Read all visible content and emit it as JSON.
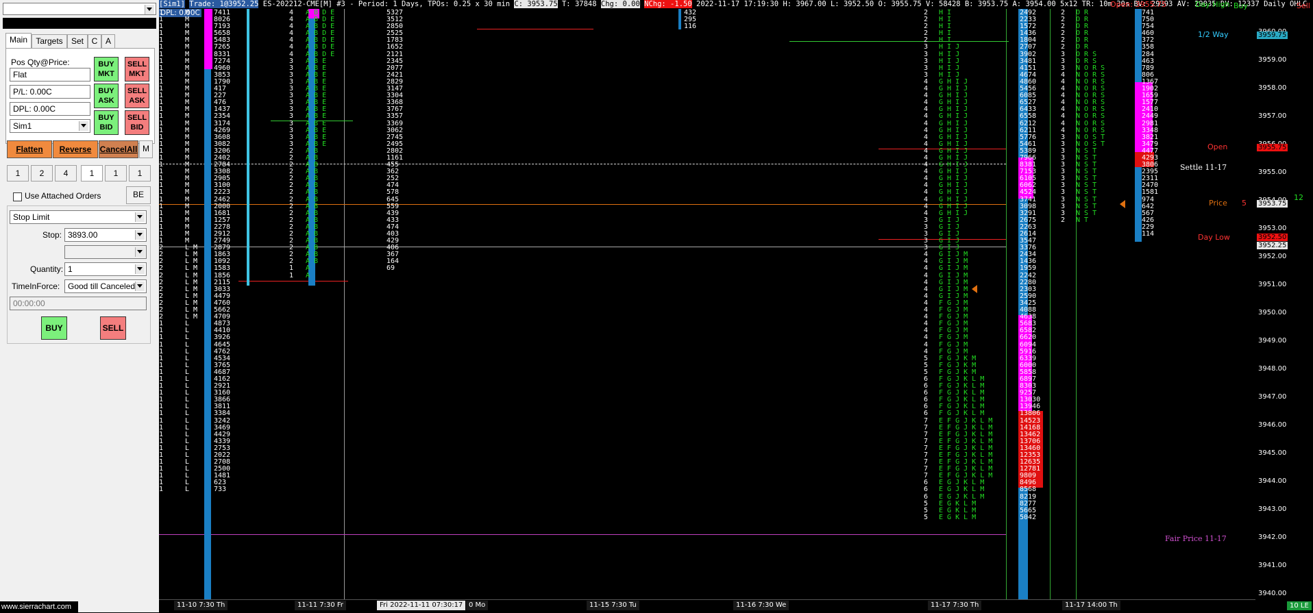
{
  "panel": {
    "symbol_select": "",
    "tabs": [
      "Main",
      "Targets",
      "Set",
      "C",
      "A"
    ],
    "pos_qty_label": "Pos Qty@Price:",
    "pos_value": "Flat",
    "pl_value": "P/L: 0.00C",
    "dpl_value": "DPL: 0.00C",
    "account": "Sim1",
    "buy_mkt": "BUY MKT",
    "sell_mkt": "SELL MKT",
    "buy_ask": "BUY ASK",
    "sell_ask": "SELL ASK",
    "buy_bid": "BUY BID",
    "sell_bid": "SELL BID",
    "flatten": "Flatten",
    "reverse": "Reverse",
    "cancel_all": "CancelAll",
    "m_button": "M",
    "qty_buttons": [
      "1",
      "2",
      "4",
      "1",
      "1",
      "1"
    ],
    "use_attached": "Use Attached Orders",
    "be_button": "BE",
    "order_type": "Stop Limit",
    "stop_label": "Stop:",
    "stop_value": "3893.00",
    "quantity_label": "Quantity:",
    "quantity_value": "1",
    "tif_label": "TimeInForce:",
    "tif_value": "Good till Canceled",
    "time_value": "00:00:00",
    "buy": "BUY",
    "sell": "SELL",
    "watermark": "www.sierrachart.com"
  },
  "header": {
    "account": "[Sim1]",
    "trade": "Trade: 1@3952.25",
    "symbol": "ES-202212-CME[M]",
    "study": "#3 - Period: 1 Days, TPOs: 0.25 x 30 min",
    "close": "C: 3953.75",
    "ticks": "T: 37848",
    "chg": "Chg: 0.00",
    "nchg": "NChg: -1.50",
    "datetime": "2022-11-17 17:19:30",
    "hlo": "H: 3967.00  L: 3952.50  O: 3955.75  V: 58428  B: 3953.75  A: 3954.00  5x12  TR: 10m 30s  BV: 29393  AV: 29035  DV: 12337  Daily OHLC",
    "open_label": "Open: 3955.75",
    "day_high": "Day High",
    "buy_col": "Buy",
    "sell_col": "Sell",
    "dpl": "DPL: 0.00C"
  },
  "price_axis": [
    {
      "p": "3960.00"
    },
    {
      "p": "3959.00"
    },
    {
      "p": "3958.00"
    },
    {
      "p": "3957.00"
    },
    {
      "p": "3956.00"
    },
    {
      "p": "3955.00"
    },
    {
      "p": "3954.00"
    },
    {
      "p": "3953.00"
    },
    {
      "p": "3952.00"
    },
    {
      "p": "3951.00"
    },
    {
      "p": "3950.00"
    },
    {
      "p": "3949.00"
    },
    {
      "p": "3948.00"
    },
    {
      "p": "3947.00"
    },
    {
      "p": "3946.00"
    },
    {
      "p": "3945.00"
    },
    {
      "p": "3944.00"
    },
    {
      "p": "3943.00"
    },
    {
      "p": "3942.00"
    },
    {
      "p": "3941.00"
    },
    {
      "p": "3940.00"
    }
  ],
  "price_tags": {
    "half_way": "3959.75",
    "open": "3955.75",
    "current": "3953.75",
    "day_low": "3952.50",
    "last": "3952.25"
  },
  "level_labels": {
    "half_way": "1/2 Way",
    "open": "Open",
    "settle": "Settle 11-17",
    "price": "Price",
    "price_qty": "5",
    "day_low": "Day Low",
    "fair_price": "Fair Price 11-17",
    "qty12": "12"
  },
  "dates": [
    "11-10  7:30 Th",
    "11-11  7:30 Fr",
    "Fri 2022-11-11  07:30:17",
    "0 Mo",
    "11-15  7:30 Tu",
    "11-16  7:30 We",
    "11-17  7:30 Th",
    "11-17  14:00 Th"
  ],
  "status": "10 LE",
  "profiles": {
    "p1_counts": "1\n1\n1\n1\n1\n1\n1\n1\n1\n1\n1\n1\n1\n1\n1\n1\n1\n1\n1\n1\n1\n1\n1\n1\n1\n1\n1\n1\n1\n1\n1\n1\n1\n1\n2\n2\n2\n2\n2\n2\n2\n2\n2\n2\n2\n1\n1\n1\n1\n1\n1\n1\n1\n1\n1\n1\n1\n1\n1\n1\n1\n1\n1\n1\n1\n1\n1\n1\n1\n1",
    "p1_letters": "M\nM\nM\nM\nM\nM\nM\nM\nM\nM\nM\nM\nM\nM\nM\nM\nM\nM\nM\nM\nM\nM\nM\nM\nM\nM\nM\nM\nM\nM\nM\nM\nM\nM\nL M\nL M\nL M\nL M\nL M\nL M\nL M\nL M\nL M\nL M\nL M\nL\nL\nL\nL\nL\nL\nL\nL\nL\nL\nL\nL\nL\nL\nL\nL\nL\nL\nL\nL\nL\nL\nL\nL\nL",
    "p1_vols": "7411\n8026\n7193\n5658\n5483\n7265\n8331\n7274\n4960\n3853\n1790\n417\n227\n476\n1437\n2354\n3174\n4269\n3608\n3082\n3206\n2402\n2784\n3308\n2905\n3100\n2223\n2462\n2000\n1681\n1257\n2278\n2912\n2749\n2879\n1863\n1092\n1583\n1856\n2115\n3033\n4479\n4760\n5662\n4709\n4873\n4410\n3926\n4645\n4762\n4534\n3765\n4687\n4162\n2921\n3160\n3866\n3811\n3384\n3242\n3469\n4429\n4339\n2753\n2022\n2708\n2500\n1481\n623\n733",
    "p2_counts": "4\n4\n4\n4\n4\n4\n4\n3\n3\n3\n3\n3\n3\n3\n3\n3\n3\n3\n3\n3\n2\n2\n2\n2\n2\n2\n2\n2\n2\n2\n2\n2\n2\n2\n2\n2\n2\n1\n1",
    "p2_letters": "A B D E\nA B D E\nA B D E\nA B D E\nA B D E\nA B D E\nA B D E\nA B E\nA B E\nA B E\nA B E\nA B E\nA B E\nA B E\nA B E\nA B E\nA B E\nA B E\nA B E\nA B E\nA B\nA B\nA B\nA B\nA B\nA B\nA B\nA B\nA B\nA B\nA B\nA B\nA B\nA B\nA B\nA B\nA B\nA\nA",
    "p2_vols": "5327\n3512\n2850\n2525\n1783\n1652\n2121\n2345\n2077\n2421\n2829\n3147\n3304\n3368\n3767\n3357\n3369\n3062\n2745\n2495\n2802\n1161\n455\n362\n252\n474\n578\n645\n559\n439\n433\n474\n403\n429\n406\n367\n164\n69",
    "p3_vols": "432\n295\n116",
    "p4_counts": "2\n2\n2\n2\n2\n3\n3\n3\n3\n3\n4\n4\n4\n4\n4\n4\n4\n4\n4\n4\n4\n4\n4\n4\n4\n4\n4\n4\n4\n4\n3\n3\n3\n3\n3\n4\n4\n4\n4\n4\n4\n4\n4\n4\n4\n4\n4\n4\n4\n4\n5\n5\n5\n6\n6\n6\n6\n6\n6\n7\n7\n7\n7\n7\n7\n7\n7\n7\n6\n6\n6\n5\n5\n5",
    "p4_letters": "H I\nH I\nH I\nH I\nH I\nH I J\nH I J\nH I J\nH I J\nH I J\nG H I J\nG H I J\nG H I J\nG H I J\nG H I J\nG H I J\nG H I J\nG H I J\nG H I J\nG H I J\nG H I J\nG H I J\nG H I J\nG H I J\nG H I J\nG H I J\nG H I J\nG H I J\nG H I J\nG H I J\nG I J\nG I J\nG I J\nG I J\nG I J\nG I J M\nG I J M\nG I J M\nG I J M\nG I J M\nG I J M\nG I J M\nF G J M\nF G J M\nF G J M\nF G J M\nF G J M\nF G J M\nF G J M\nF G J M\nF G J K M\nF G J K M\nF G J K M\nF G J K L M\nF G J K L M\nF G J K L M\nF G J K L M\nF G J K L M\nF G J K L M\nE F G J K L M\nE F G J K L M\nE F G J K L M\nE F G J K L M\nE F G J K L M\nE F G J K L M\nE F G J K L M\nE F G J K L M\nE F G J K L M\nE G J K L M\nE G J K L M\nE G J K L M\nE G K L M\nE G K L M\nE G K L M",
    "p4_vols": "2492\n2233\n1572\n1436\n1804\n2707\n3902\n3481\n4151\n4674\n4860\n5456\n6085\n6527\n6433\n6558\n6212\n6211\n5776\n5461\n5389\n7966\n8381\n7153\n6105\n6062\n4524\n3741\n3098\n3291\n2675\n2263\n2614\n3547\n3376\n2434\n1436\n1959\n2242\n2280\n2303\n2590\n3425\n4088\n4638\n5683\n6582\n6620\n6094\n5916\n6339\n6000\n5858\n6897\n8303\n9257\n13030\n13946\n13806\n14523\n14168\n13462\n13706\n13460\n12353\n12635\n12781\n9809\n8496\n8568\n8219\n8277\n5665\n5042",
    "p5_counts": "2\n2\n2\n2\n2\n2\n3\n3\n3\n4\n4\n4\n4\n4\n4\n4\n4\n4\n3\n3\n3\n3\n3\n3\n3\n3\n3\n3\n3\n3\n2",
    "p5_letters": "O R\nO R\nO R\nO R\nO R\nO R\nO R S\nO R S\nN O R S\nN O R S\nN O R S\nN O R S\nN O R S\nN O R S\nN O R S\nN O R S\nN O R S\nN O R S\nN O S T\nN O S T\nN S T\nN S T\nN S T\nN S T\nN S T\nN S T\nN S T\nN S T\nN S T\nN S T\nN T",
    "p5_vols": "741\n750\n754\n460\n372\n358\n284\n463\n789\n806\n1367\n1902\n1659\n1577\n2410\n2449\n2981\n3348\n3821\n3479\n4477\n4293\n3806\n2395\n2311\n2470\n1581\n974\n642\n567\n426\n229\n114"
  }
}
